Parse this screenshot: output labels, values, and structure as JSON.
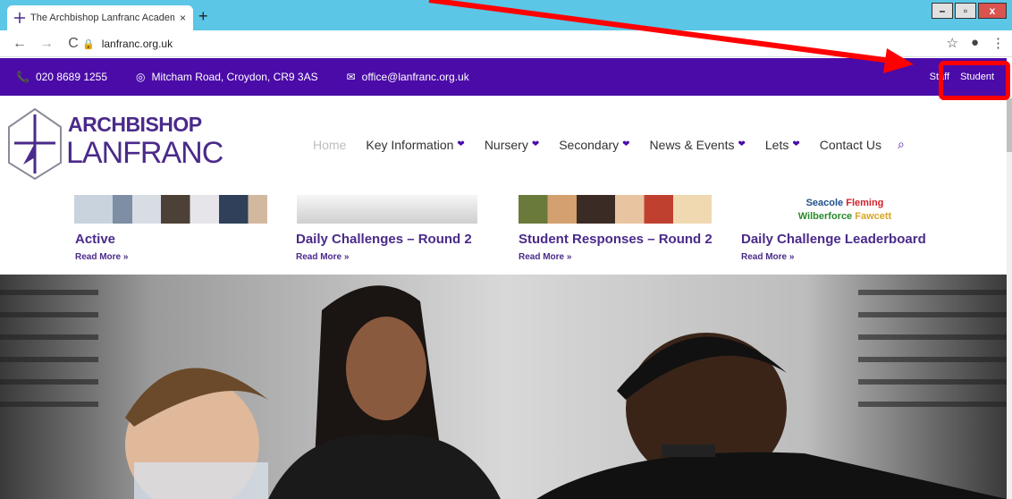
{
  "browser": {
    "tab_title": "The Archbishop Lanfranc Academ",
    "tab_close": "×",
    "new_tab": "+",
    "url": "lanfranc.org.uk",
    "win_min": "–",
    "win_max": "▫",
    "win_close": "x"
  },
  "topbar": {
    "phone": "020 8689 1255",
    "address": "Mitcham Road, Croydon, CR9 3AS",
    "email": "office@lanfranc.org.uk",
    "staff": "Staff",
    "student": "Student"
  },
  "logo": {
    "line1": "ARCHBISHOP",
    "line2": "LANFRANC"
  },
  "nav": {
    "items": [
      "Home",
      "Key Information",
      "Nursery",
      "Secondary",
      "News & Events",
      "Lets",
      "Contact Us"
    ]
  },
  "posts": [
    {
      "title": "Active",
      "more": "Read More »"
    },
    {
      "title": "Daily Challenges – Round 2",
      "more": "Read More »"
    },
    {
      "title": "Student Responses – Round 2",
      "more": "Read More »"
    },
    {
      "title": "Daily Challenge Leaderboard",
      "more": "Read More »"
    }
  ],
  "leaderboard_image": {
    "seacole": "Seacole",
    "fleming": "Fleming",
    "wilberforce": "Wilberforce",
    "fawcett": "Fawcett"
  },
  "colors": {
    "brand_purple": "#4b0ba8",
    "annotation_red": "#ff0000"
  }
}
